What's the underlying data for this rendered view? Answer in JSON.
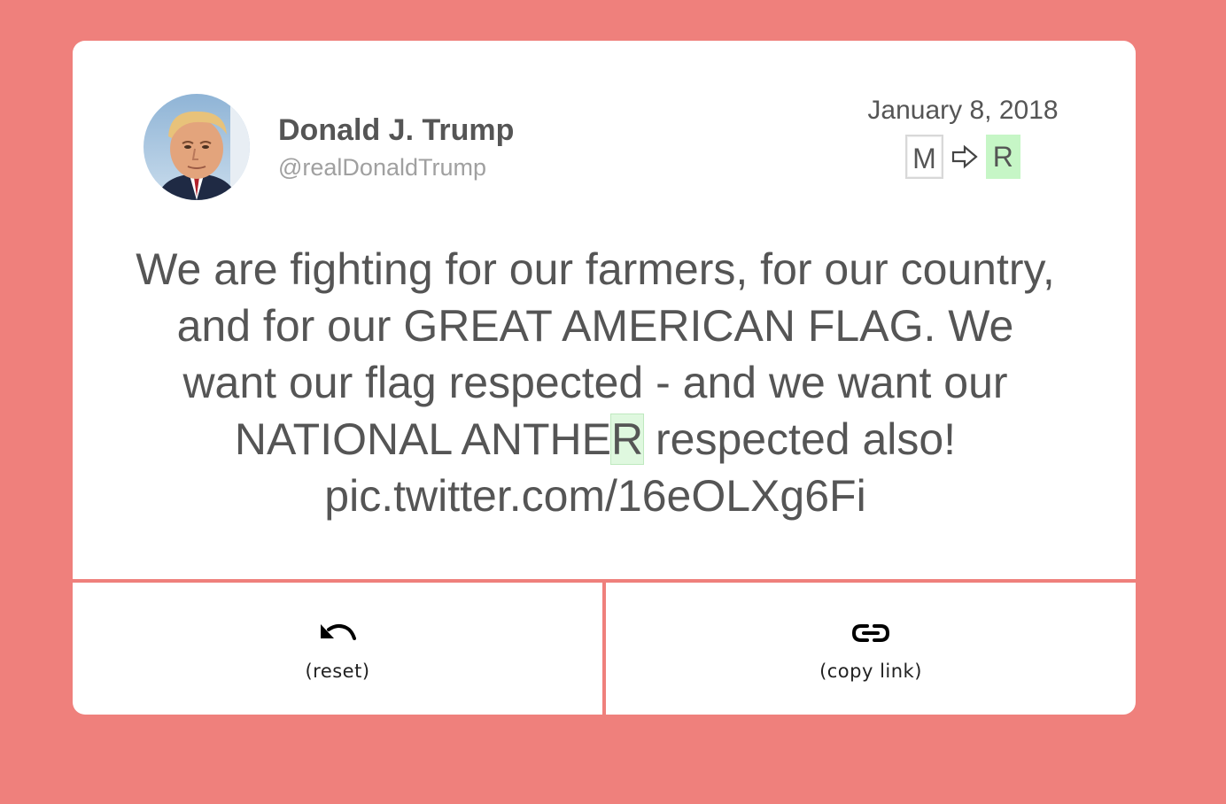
{
  "colors": {
    "background": "#ef807c",
    "card": "#ffffff",
    "text": "#555555",
    "handle": "#a0a0a0",
    "new_letter_highlight": "#c6f6c6"
  },
  "profile": {
    "name": "Donald J. Trump",
    "handle": "@realDonaldTrump",
    "avatar_icon": "profile-photo"
  },
  "date": "January 8, 2018",
  "letter_change": {
    "from": "M",
    "to": "R",
    "arrow_icon": "arrow-right-icon"
  },
  "tweet": {
    "before": "We are fighting for our farmers, for our country, and for our GREAT AMERICAN FLAG. We want our flag respected - and we want our NATIONAL ANTHE",
    "highlight": "R",
    "after": " respected also! pic.twitter.com/16eOLXg6Fi"
  },
  "actions": {
    "reset_label": "(reset)",
    "reset_icon": "undo-icon",
    "copy_label": "(copy link)",
    "copy_icon": "link-icon"
  }
}
